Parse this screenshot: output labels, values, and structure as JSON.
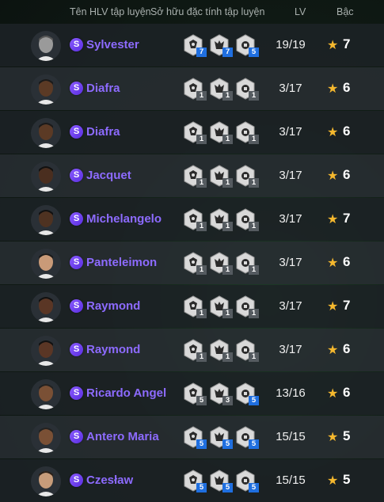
{
  "header": {
    "name_col": "Tên HLV tập luyện",
    "traits_col": "Sở hữu đặc tính tập luyện",
    "lv_col": "LV",
    "tier_col": "Bậc"
  },
  "badge_letter": "S",
  "colors": {
    "name": "#8d6bff",
    "badge": "#6a3df0",
    "star": "#f5b82e",
    "count_blue": "#1f6fe0"
  },
  "rows": [
    {
      "name": "Sylvester",
      "lv": "19/19",
      "tier": "7",
      "skin": "#9a9a9a",
      "hair": "#555",
      "traits": [
        {
          "icon": "trait-icon-1",
          "count": "7",
          "blue": true
        },
        {
          "icon": "trait-icon-2",
          "count": "7",
          "blue": true
        },
        {
          "icon": "trait-icon-3",
          "count": "5",
          "blue": true
        }
      ]
    },
    {
      "name": "Diafra",
      "lv": "3/17",
      "tier": "6",
      "skin": "#5b3a25",
      "hair": "#1a1a1a",
      "traits": [
        {
          "icon": "trait-icon-1",
          "count": "1",
          "blue": false
        },
        {
          "icon": "trait-icon-2",
          "count": "1",
          "blue": false
        },
        {
          "icon": "trait-icon-3",
          "count": "1",
          "blue": false
        }
      ]
    },
    {
      "name": "Diafra",
      "lv": "3/17",
      "tier": "6",
      "skin": "#5b3a25",
      "hair": "#1a1a1a",
      "traits": [
        {
          "icon": "trait-icon-1",
          "count": "1",
          "blue": false
        },
        {
          "icon": "trait-icon-2",
          "count": "1",
          "blue": false
        },
        {
          "icon": "trait-icon-3",
          "count": "1",
          "blue": false
        }
      ]
    },
    {
      "name": "Jacquet",
      "lv": "3/17",
      "tier": "6",
      "skin": "#4a2e1f",
      "hair": "#111",
      "traits": [
        {
          "icon": "trait-icon-1",
          "count": "1",
          "blue": false
        },
        {
          "icon": "trait-icon-2",
          "count": "1",
          "blue": false
        },
        {
          "icon": "trait-icon-3",
          "count": "1",
          "blue": false
        }
      ]
    },
    {
      "name": "Michelangelo",
      "lv": "3/17",
      "tier": "7",
      "skin": "#4e3221",
      "hair": "#111",
      "traits": [
        {
          "icon": "trait-icon-1",
          "count": "1",
          "blue": false
        },
        {
          "icon": "trait-icon-2",
          "count": "1",
          "blue": false
        },
        {
          "icon": "trait-icon-3",
          "count": "1",
          "blue": false
        }
      ]
    },
    {
      "name": "Panteleimon",
      "lv": "3/17",
      "tier": "6",
      "skin": "#c99a78",
      "hair": "#1a1a1a",
      "traits": [
        {
          "icon": "trait-icon-1",
          "count": "1",
          "blue": false
        },
        {
          "icon": "trait-icon-2",
          "count": "1",
          "blue": false
        },
        {
          "icon": "trait-icon-3",
          "count": "1",
          "blue": false
        }
      ]
    },
    {
      "name": "Raymond",
      "lv": "3/17",
      "tier": "7",
      "skin": "#5a3625",
      "hair": "#111",
      "traits": [
        {
          "icon": "trait-icon-1",
          "count": "1",
          "blue": false
        },
        {
          "icon": "trait-icon-2",
          "count": "1",
          "blue": false
        },
        {
          "icon": "trait-icon-3",
          "count": "1",
          "blue": false
        }
      ]
    },
    {
      "name": "Raymond",
      "lv": "3/17",
      "tier": "6",
      "skin": "#5a3625",
      "hair": "#111",
      "traits": [
        {
          "icon": "trait-icon-1",
          "count": "1",
          "blue": false
        },
        {
          "icon": "trait-icon-2",
          "count": "1",
          "blue": false
        },
        {
          "icon": "trait-icon-3",
          "count": "1",
          "blue": false
        }
      ]
    },
    {
      "name": "Ricardo Angel",
      "lv": "13/16",
      "tier": "6",
      "skin": "#7a5035",
      "hair": "#222",
      "traits": [
        {
          "icon": "trait-icon-1",
          "count": "5",
          "blue": false
        },
        {
          "icon": "trait-icon-2",
          "count": "3",
          "blue": false
        },
        {
          "icon": "trait-icon-3",
          "count": "5",
          "blue": true
        }
      ]
    },
    {
      "name": "Antero Maria",
      "lv": "15/15",
      "tier": "5",
      "skin": "#7a5035",
      "hair": "#222",
      "traits": [
        {
          "icon": "trait-icon-1",
          "count": "5",
          "blue": true
        },
        {
          "icon": "trait-icon-2",
          "count": "5",
          "blue": true
        },
        {
          "icon": "trait-icon-3",
          "count": "5",
          "blue": true
        }
      ]
    },
    {
      "name": "Czesław",
      "lv": "15/15",
      "tier": "5",
      "skin": "#c79c7a",
      "hair": "#2a2018",
      "traits": [
        {
          "icon": "trait-icon-1",
          "count": "5",
          "blue": true
        },
        {
          "icon": "trait-icon-2",
          "count": "5",
          "blue": true
        },
        {
          "icon": "trait-icon-3",
          "count": "5",
          "blue": true
        }
      ]
    }
  ]
}
